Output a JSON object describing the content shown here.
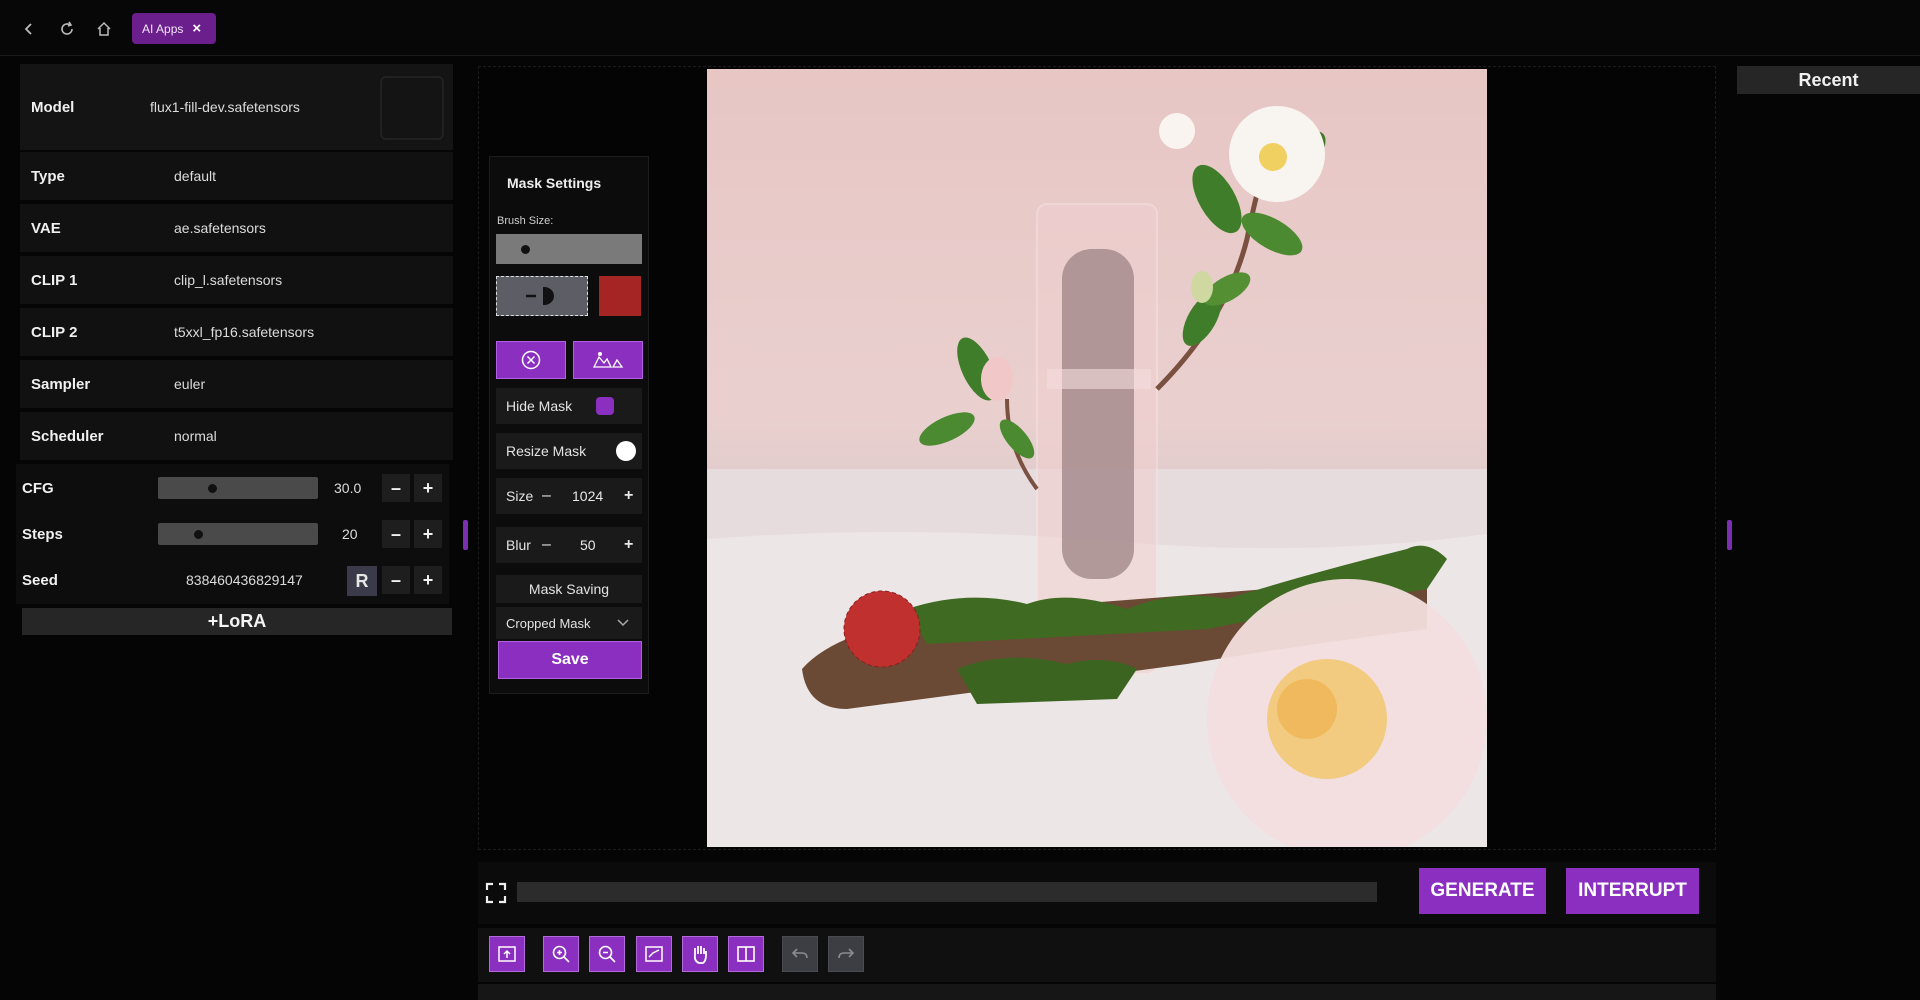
{
  "topbar": {
    "tab_label": "AI Apps",
    "tab_close": "×"
  },
  "settings": {
    "model": {
      "label": "Model",
      "value": "flux1-fill-dev.safetensors"
    },
    "type": {
      "label": "Type",
      "value": "default"
    },
    "vae": {
      "label": "VAE",
      "value": "ae.safetensors"
    },
    "clip1": {
      "label": "CLIP 1",
      "value": "clip_l.safetensors"
    },
    "clip2": {
      "label": "CLIP 2",
      "value": "t5xxl_fp16.safetensors"
    },
    "sampler": {
      "label": "Sampler",
      "value": "euler"
    },
    "scheduler": {
      "label": "Scheduler",
      "value": "normal"
    },
    "cfg": {
      "label": "CFG",
      "value": "30.0",
      "slider_fraction": 0.33
    },
    "steps": {
      "label": "Steps",
      "value": "20",
      "slider_fraction": 0.24
    },
    "seed": {
      "label": "Seed",
      "value": "838460436829147",
      "random_label": "R"
    },
    "minus": "–",
    "plus": "+",
    "lora_label": "+LoRA"
  },
  "mask_settings": {
    "title": "Mask Settings",
    "brush_size_label": "Brush Size:",
    "brush_color": "#a52424",
    "hide_mask_label": "Hide Mask",
    "resize_mask_label": "Resize Mask",
    "size_label": "Size",
    "size_value": "1024",
    "blur_label": "Blur",
    "blur_value": "50",
    "mask_saving_label": "Mask Saving",
    "mask_saving_selected": "Cropped Mask",
    "save_label": "Save"
  },
  "actions": {
    "generate_label": "GENERATE",
    "interrupt_label": "INTERRUPT"
  },
  "recent": {
    "title": "Recent"
  },
  "colors": {
    "accent": "#8a2fbf",
    "panel": "#111111",
    "background": "#050505"
  },
  "icons": [
    "back-icon",
    "refresh-icon",
    "home-icon",
    "close-icon",
    "fullscreen-icon",
    "upload-image-icon",
    "zoom-in-icon",
    "zoom-out-icon",
    "fit-image-icon",
    "hand-pan-icon",
    "split-view-icon",
    "undo-icon",
    "redo-icon",
    "clear-mask-icon",
    "invert-mask-icon",
    "brush-icon",
    "chevron-down-icon"
  ]
}
